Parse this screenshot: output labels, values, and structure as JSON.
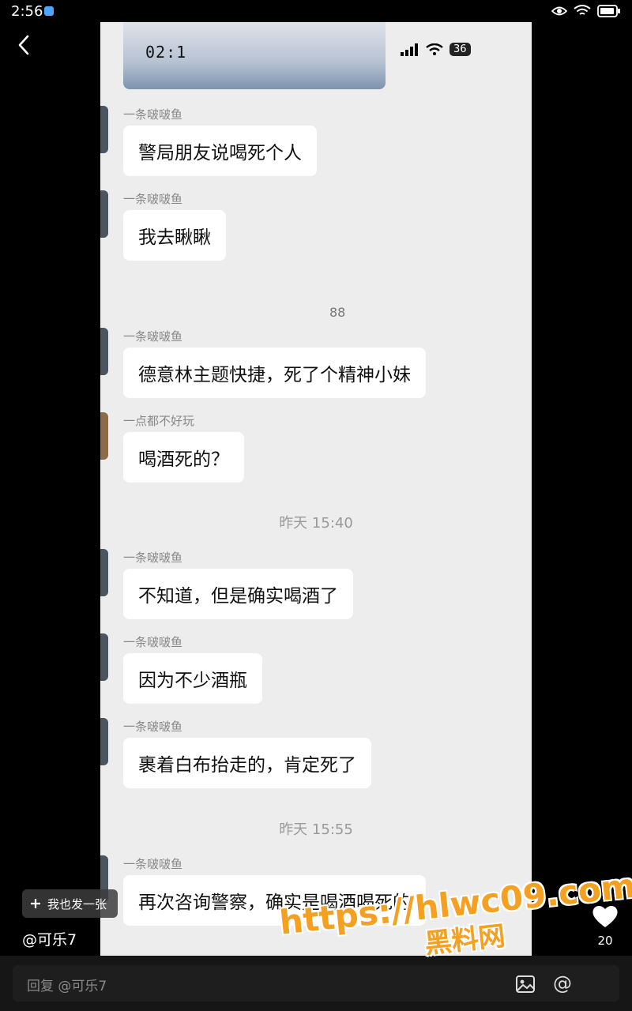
{
  "status_bar": {
    "time": "2:56",
    "icons": [
      "eye-icon",
      "wifi-icon",
      "battery-icon"
    ]
  },
  "back": {
    "icon": "chevron-left-icon"
  },
  "screenshot": {
    "top_image_text": "02:1",
    "inner_battery": "36",
    "messages": [
      {
        "sender": "一条啵啵鱼",
        "text": "警局朋友说喝死个人"
      },
      {
        "sender": "一条啵啵鱼",
        "text": "我去瞅瞅"
      },
      {
        "sender": "一条啵啵鱼",
        "text": "德意林主题快捷，死了个精神小妹"
      },
      {
        "sender": "一点都不好玩",
        "text": "喝酒死的？"
      },
      {
        "sender": "一条啵啵鱼",
        "text": "不知道，但是确实喝酒了"
      },
      {
        "sender": "一条啵啵鱼",
        "text": "因为不少酒瓶"
      },
      {
        "sender": "一条啵啵鱼",
        "text": "裹着白布抬走的，肯定死了"
      },
      {
        "sender": "一条啵啵鱼",
        "text": "再次咨询警察，确实是喝酒喝死的"
      }
    ],
    "time_dividers": [
      "昨天 15:40",
      "昨天 15:55"
    ],
    "blurred_text_right": "88"
  },
  "overlay": {
    "add_button_label": "我也发一张",
    "username": "@可乐7",
    "like_count": "20"
  },
  "watermark": {
    "url": "https://hlwc09.com",
    "name": "黑料网",
    "color": "#f5a020"
  },
  "reply_bar": {
    "placeholder": "回复 @可乐7"
  }
}
